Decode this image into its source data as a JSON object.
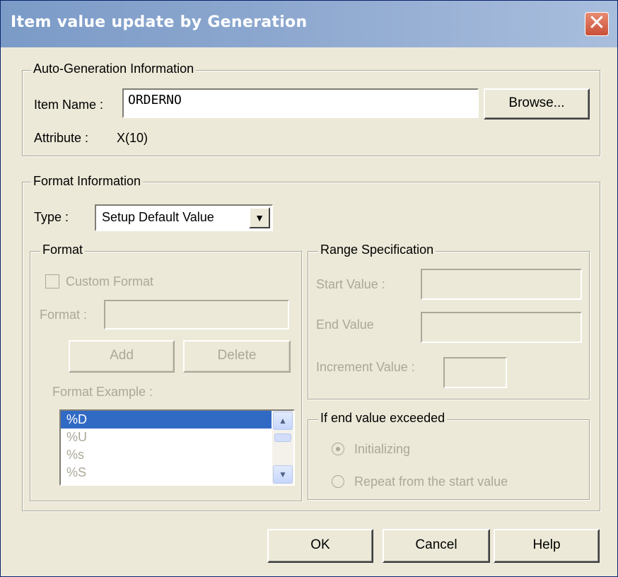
{
  "dialog": {
    "title": "Item value update by Generation",
    "close_glyph": "✕"
  },
  "auto_generation": {
    "legend": "Auto-Generation Information",
    "item_name_label": "Item Name :",
    "item_name_value": "ORDERNO",
    "browse_label": "Browse...",
    "attribute_label": "Attribute :",
    "attribute_value": "X(10)"
  },
  "format_info": {
    "legend": "Format Information",
    "type_label": "Type :",
    "type_value": "Setup Default Value",
    "type_arrow": "▼"
  },
  "format": {
    "legend": "Format",
    "custom_format_label": "Custom Format",
    "custom_format_checked": false,
    "format_label": "Format :",
    "format_value": "",
    "add_label": "Add",
    "delete_label": "Delete",
    "example_label": "Format Example :",
    "examples": [
      "%D",
      "%U",
      "%s",
      "%S"
    ],
    "selected_example": "%D",
    "scroll_up": "▲",
    "scroll_down": "▼"
  },
  "range": {
    "legend": "Range Specification",
    "start_label": "Start Value :",
    "start_value": "",
    "end_label": "End Value",
    "end_value": "",
    "increment_label": "Increment Value :",
    "increment_value": ""
  },
  "exceeded": {
    "legend": "If end value exceeded",
    "options": [
      "Initializing",
      "Repeat from the start value"
    ],
    "selected": "Initializing"
  },
  "footer": {
    "ok_label": "OK",
    "cancel_label": "Cancel",
    "help_label": "Help"
  },
  "colors": {
    "titlebar": "#8fa9d0",
    "face": "#ece9d8",
    "selection": "#316ac5",
    "disabled_text": "#aca899"
  }
}
